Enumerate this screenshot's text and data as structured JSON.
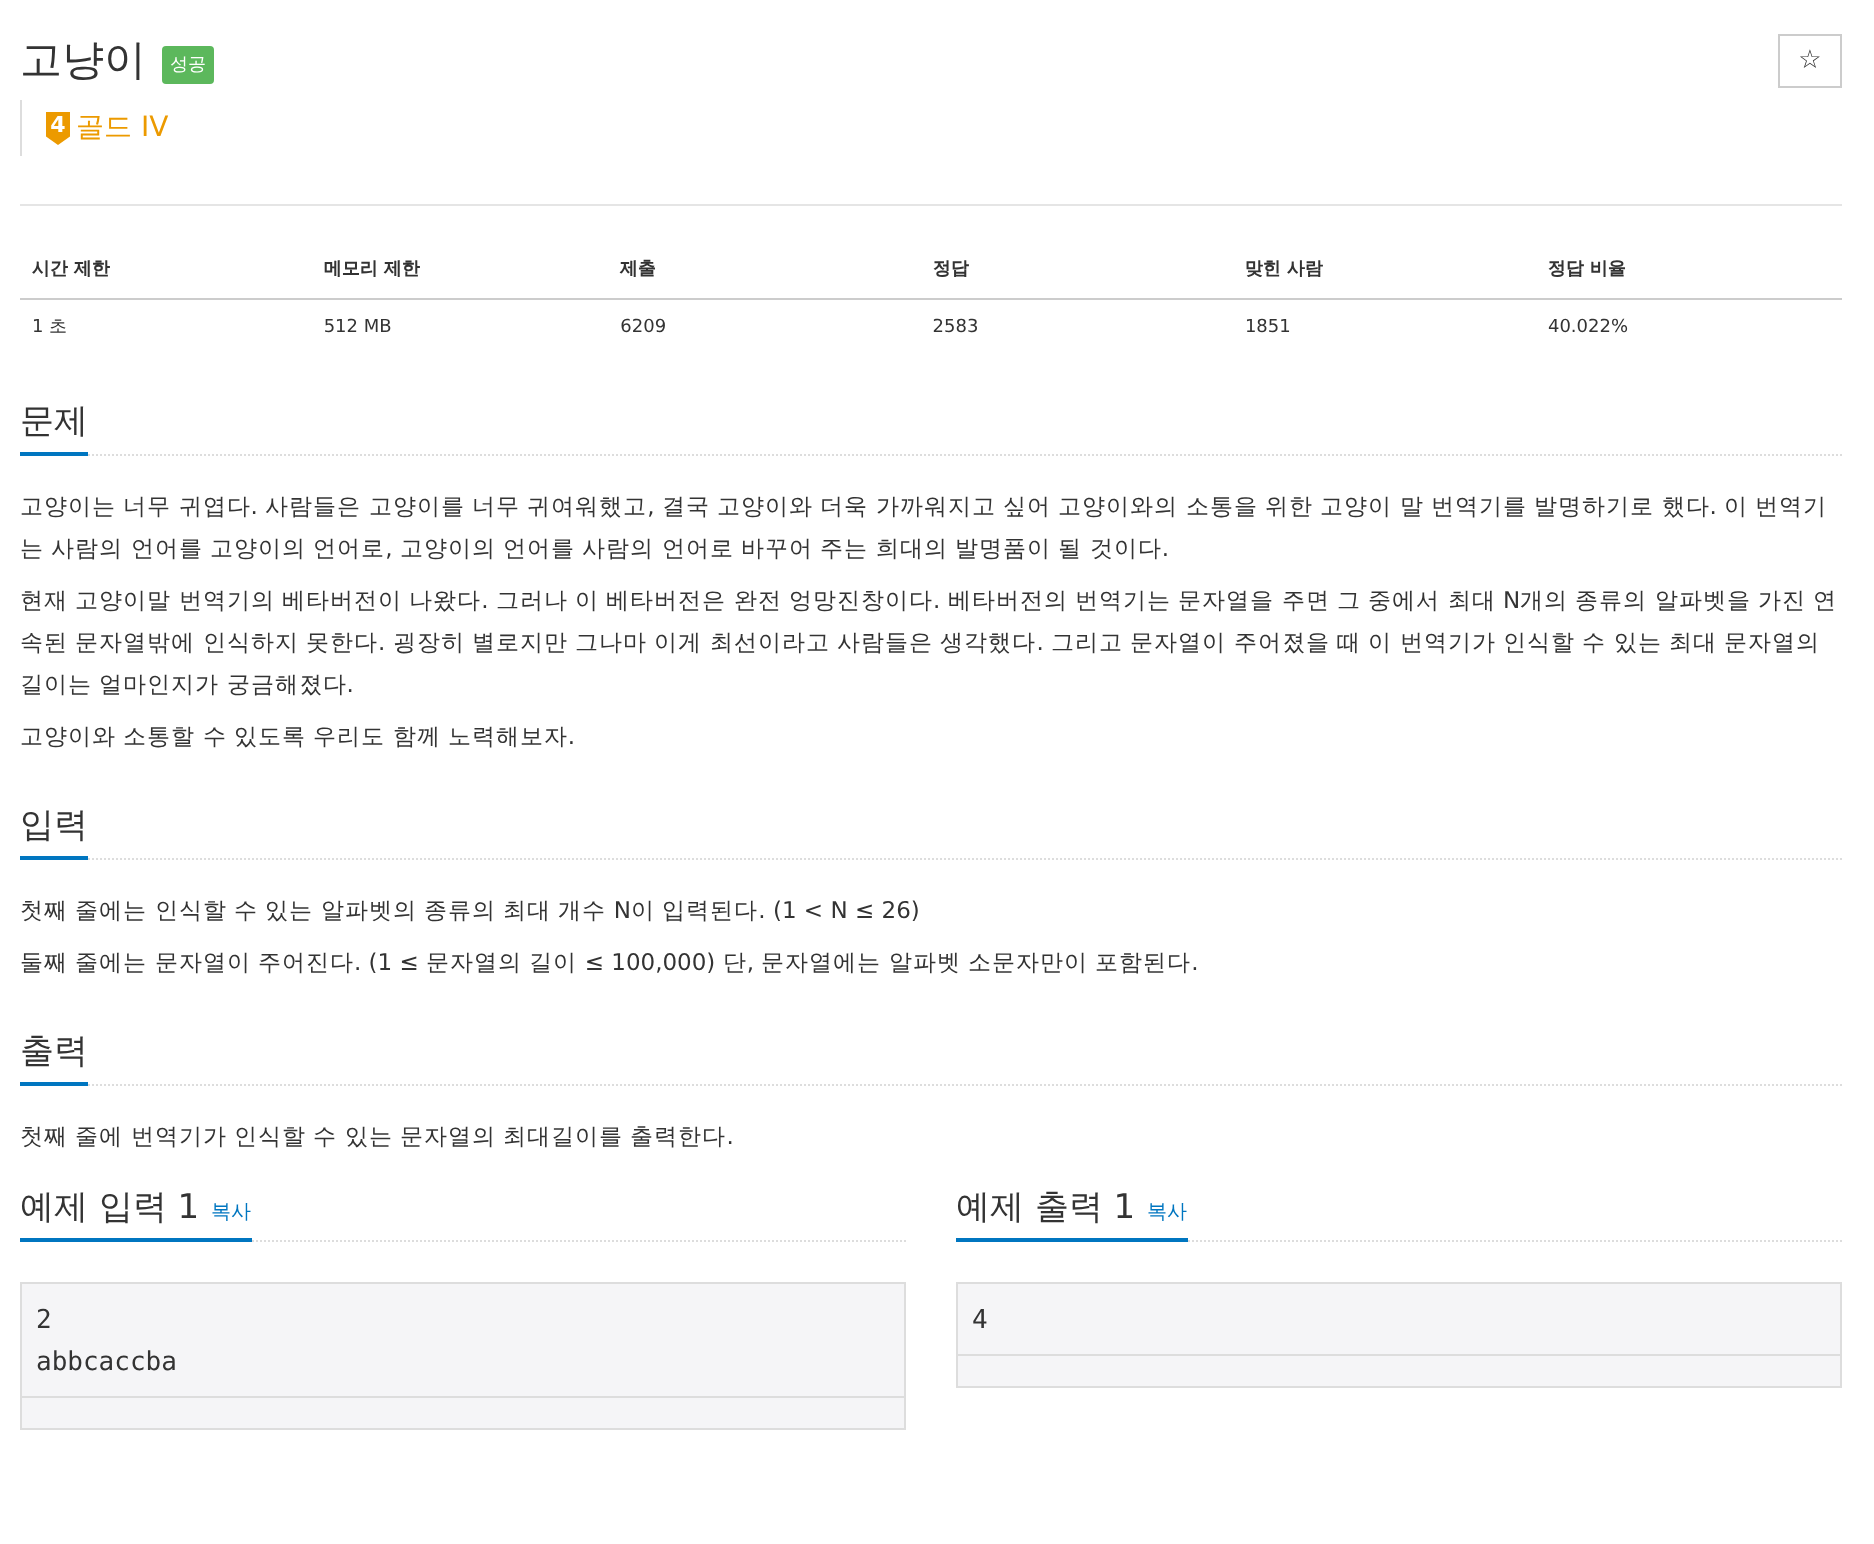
{
  "title": "고냥이",
  "result_badge": "성공",
  "favorite": {
    "starred": false,
    "icon": "☆"
  },
  "tier": {
    "number": "4",
    "label": "골드 IV"
  },
  "info_table": {
    "columns": [
      "시간 제한",
      "메모리 제한",
      "제출",
      "정답",
      "맞힌 사람",
      "정답 비율"
    ],
    "rows": [
      [
        "1 초",
        "512 MB",
        "6209",
        "2583",
        "1851",
        "40.022%"
      ]
    ]
  },
  "sections": [
    {
      "heading": "문제",
      "paragraphs": [
        "고양이는 너무 귀엽다. 사람들은 고양이를 너무 귀여워했고, 결국 고양이와 더욱 가까워지고 싶어 고양이와의 소통을 위한 고양이 말 번역기를 발명하기로 했다. 이 번역기는 사람의 언어를 고양이의 언어로, 고양이의 언어를 사람의 언어로 바꾸어 주는 희대의 발명품이 될 것이다.",
        "현재 고양이말 번역기의 베타버전이 나왔다. 그러나 이 베타버전은 완전 엉망진창이다. 베타버전의 번역기는 문자열을 주면 그 중에서 최대 N개의 종류의 알파벳을 가진 연속된 문자열밖에 인식하지 못한다. 굉장히 별로지만 그나마 이게 최선이라고 사람들은 생각했다. 그리고 문자열이 주어졌을 때 이 번역기가 인식할 수 있는 최대 문자열의 길이는 얼마인지가 궁금해졌다.",
        "고양이와 소통할 수 있도록 우리도 함께 노력해보자."
      ]
    },
    {
      "heading": "입력",
      "paragraphs": [
        "첫째 줄에는 인식할 수 있는 알파벳의 종류의 최대 개수 N이 입력된다. (1 < N ≤ 26)",
        "둘째 줄에는 문자열이 주어진다. (1 ≤ 문자열의 길이 ≤ 100,000) 단, 문자열에는 알파벳 소문자만이 포함된다."
      ]
    },
    {
      "heading": "출력",
      "paragraphs": [
        "첫째 줄에 번역기가 인식할 수 있는 문자열의 최대길이를 출력한다."
      ]
    }
  ],
  "samples": [
    {
      "heading": "예제 입력 1",
      "copy": "복사",
      "lines": [
        "2",
        "abbcaccba"
      ]
    },
    {
      "heading": "예제 출력 1",
      "copy": "복사",
      "lines": [
        "4"
      ]
    }
  ]
}
